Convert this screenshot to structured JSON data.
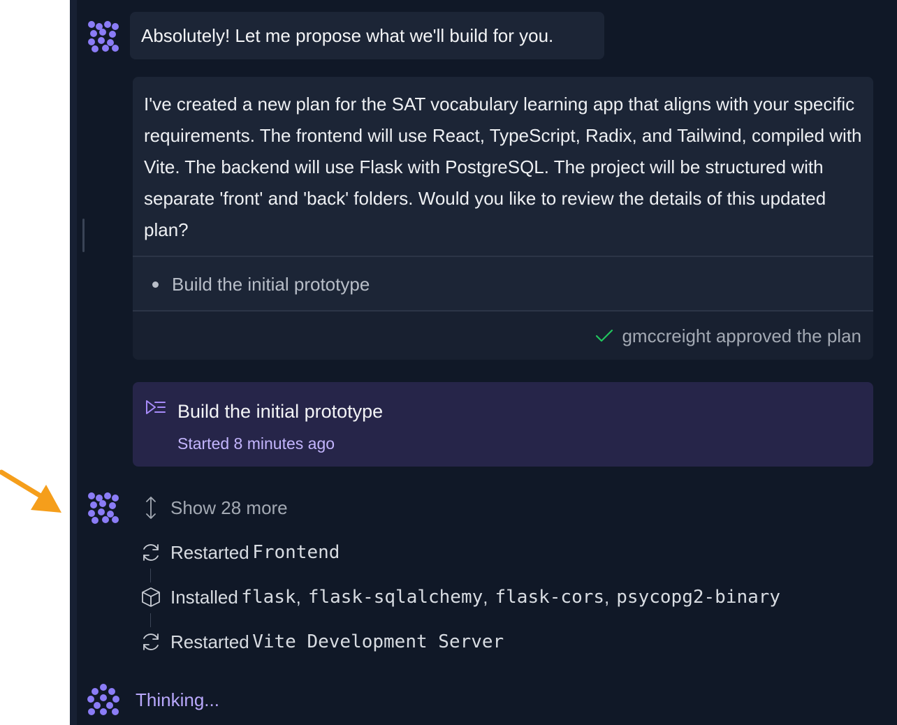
{
  "messages": {
    "greeting": "Absolutely! Let me propose what we'll build for you.",
    "plan": {
      "description": "I've created a new plan for the SAT vocabulary learning app that aligns with your specific requirements. The frontend will use React, TypeScript, Radix, and Tailwind, compiled with Vite. The backend will use Flask with PostgreSQL. The project will be structured with separate 'front' and 'back' folders. Would you like to review the details of this updated plan?",
      "items": [
        "Build the initial prototype"
      ],
      "approval": "gmccreight approved the plan"
    }
  },
  "task": {
    "title": "Build the initial prototype",
    "status_label": "Started",
    "status_time": "8 minutes ago"
  },
  "activity": {
    "show_more": "Show 28 more",
    "entries": [
      {
        "icon": "refresh-icon",
        "verb": "Restarted",
        "targets": [
          "Frontend"
        ]
      },
      {
        "icon": "package-icon",
        "verb": "Installed",
        "targets": [
          "flask",
          "flask-sqlalchemy",
          "flask-cors",
          "psycopg2-binary"
        ]
      },
      {
        "icon": "refresh-icon",
        "verb": "Restarted",
        "targets": [
          "Vite Development Server"
        ]
      }
    ]
  },
  "thinking": "Thinking...",
  "colors": {
    "panel_bg": "#101827",
    "card_bg": "#1c2536",
    "task_bg": "#262549",
    "accent_purple": "#8b7cf6",
    "approve_green": "#22c55e",
    "arrow_orange": "#f59e1b"
  }
}
